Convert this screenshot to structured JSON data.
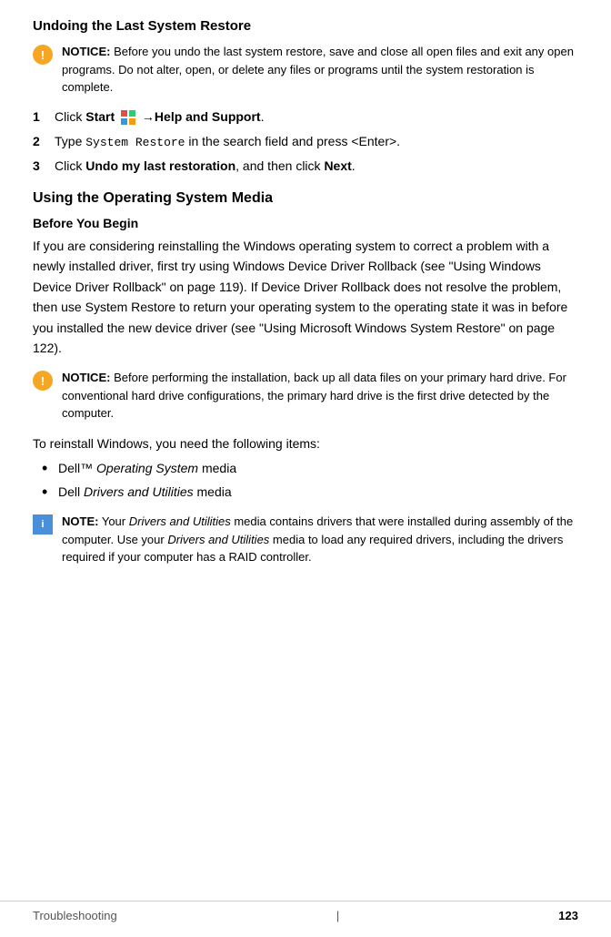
{
  "page": {
    "title": "Undoing the Last System Restore",
    "section2_title": "Using the Operating System Media",
    "subsection_title": "Before You Begin",
    "footer": {
      "section": "Troubleshooting",
      "page_number": "123",
      "separator": "|"
    }
  },
  "notice1": {
    "label": "NOTICE:",
    "text": "Before you undo the last system restore, save and close all open files and exit any open programs. Do not alter, open, or delete any files or programs until the system restoration is complete."
  },
  "steps": [
    {
      "number": "1",
      "text_before": "Click ",
      "bold": "Start",
      "has_icon": true,
      "arrow": "→",
      "bold2": "Help and Support",
      "text_after": "."
    },
    {
      "number": "2",
      "text_before": "Type ",
      "code": "System Restore",
      "text_after": " in the search field and press <Enter>."
    },
    {
      "number": "3",
      "text_before": "Click ",
      "bold": "Undo my last restoration",
      "text_after": ", and then click ",
      "bold2": "Next",
      "text_end": "."
    }
  ],
  "body_text": "If you are considering reinstalling the Windows operating system to correct a problem with a newly installed driver, first try using Windows Device Driver Rollback (see \"Using Windows Device Driver Rollback\" on page 119). If Device Driver Rollback does not resolve the problem, then use System Restore to return your operating system to the operating state it was in before you installed the new device driver (see \"Using Microsoft Windows System Restore\" on page 122).",
  "notice2": {
    "label": "NOTICE:",
    "text": "Before performing the installation, back up all data files on your primary hard drive. For conventional hard drive configurations, the primary hard drive is the first drive detected by the computer."
  },
  "to_reinstall_text": "To reinstall Windows, you need the following items:",
  "bullet_items": [
    {
      "text_before": "Dell™ ",
      "italic": "Operating System",
      "text_after": " media"
    },
    {
      "text_before": "Dell ",
      "italic": "Drivers and Utilities",
      "text_after": " media"
    }
  ],
  "note": {
    "label": "NOTE:",
    "text_before": "Your ",
    "italic1": "Drivers and Utilities",
    "text_mid": " media contains drivers that were installed during assembly of the computer. Use your ",
    "italic2": "Drivers and Utilities",
    "text_after": " media to load any required drivers, including the drivers required if your computer has a RAID controller."
  }
}
